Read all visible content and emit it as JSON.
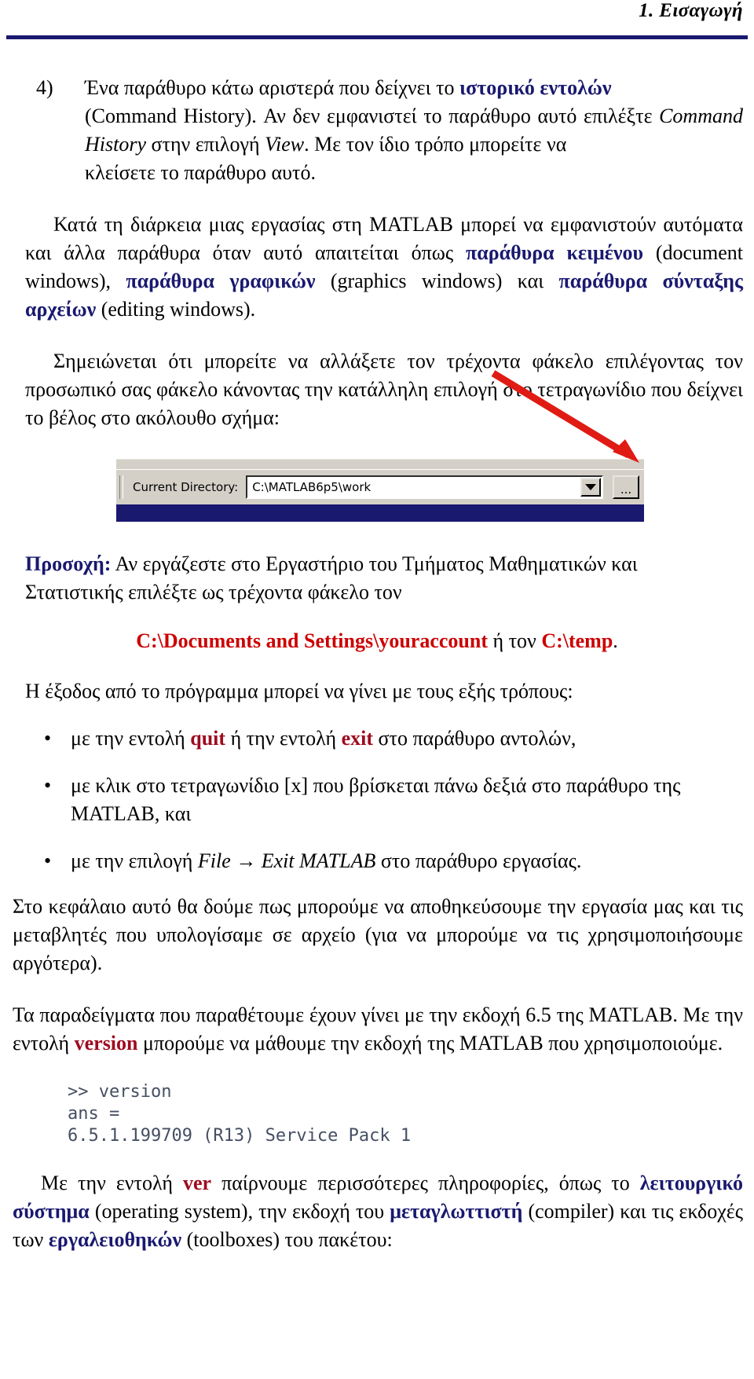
{
  "header": {
    "title": "1. Εισαγωγή",
    "rule_color": "#191970"
  },
  "colors": {
    "navy": "#191970",
    "red": "#cc0000",
    "dark_red": "#9e0b1f",
    "arrow_red": "#e01b14",
    "code_text": "#454f63",
    "toolbar_face": "#d4d0c8"
  },
  "item4": {
    "marker": "4)",
    "line1_pre": "Ένα παράθυρο κάτω αριστερά που δείχνει το ",
    "line1_em": "ιστορικό εντολών",
    "line2_pre": "(Command History). Αν δεν εμφανιστεί το παράθυρο αυτό επιλέξτε ",
    "line2_it1": "Command History",
    "line2_mid": " στην επιλογή ",
    "line2_it2": "View",
    "line2_post": ". Με τον ίδιο τρόπο μπορείτε να",
    "line3": "κλείσετε το παράθυρο αυτό."
  },
  "para_windows": {
    "t1": "Κατά τη διάρκεια μιας εργασίας στη MATLAB μπορεί να εμφανιστούν αυτόματα και άλλα παράθυρα όταν αυτό απαιτείται όπως ",
    "em1": "παράθυρα κειμένου",
    "t2": " (document windows), ",
    "em2": "παράθυρα γραφικών",
    "t3": " (graphics windows) και ",
    "em3": "παράθυρα σύνταξης αρχείων",
    "t4": " (editing windows)."
  },
  "para_folder": {
    "text": "Σημειώνεται ότι μπορείτε να αλλάξετε τον τρέχοντα φάκελο επιλέγοντας τον προσωπικό σας φάκελο κάνοντας την κατάλληλη επιλογή στο τετραγωνίδιο που δείχνει το βέλος στο ακόλουθο σχήμα:"
  },
  "screenshot": {
    "label": "Current Directory:",
    "path_value": "C:\\MATLAB6p5\\work",
    "dropdown_icon": "chevron-down-icon",
    "browse_label": "...",
    "arrow_icon": "red-arrow-annotation"
  },
  "para_attention": {
    "bold": "Προσοχή:",
    "t1": " Αν εργάζεστε στο Εργαστήριο του Τμήματος Μαθηματικών και ",
    "t2": "Στατιστικής επιλέξτε ως τρέχοντα φάκελο τον"
  },
  "path_line": {
    "path1": "C:\\Documents and Settings\\youraccount",
    "middle": " ή τον ",
    "path2": "C:\\temp",
    "end": "."
  },
  "para_exit": {
    "text": "Η έξοδος από το πρόγραμμα μπορεί να γίνει με τους εξής τρόπους:"
  },
  "bullets": {
    "dot": "•",
    "items": [
      {
        "t1": "με την εντολή ",
        "cmd1": "quit",
        "t2": " ή την εντολή ",
        "cmd2": "exit",
        "t3": " στο παράθυρο αντολών,"
      },
      {
        "line1": "με κλικ στο τετραγωνίδιο [x] που βρίσκεται πάνω δεξιά στο παράθυρο της",
        "line2": "MATLAB, και"
      },
      {
        "t1": "με την επιλογή ",
        "menu": "File → Exit MATLAB",
        "t2": " στο παράθυρο εργασίας."
      }
    ]
  },
  "para_chapter": {
    "text": "Στο κεφάλαιο αυτό θα δούμε πως μπορούμε να αποθηκεύσουμε την εργασία μας και τις μεταβλητές που υπολογίσαμε σε αρχείο (για να μπορούμε να τις χρησιμοποιήσουμε αργότερα)."
  },
  "para_version": {
    "t1": "Τα παραδείγματα που παραθέτουμε έχουν γίνει με την εκδοχή 6.5 της MATLAB. Με την εντολή ",
    "cmd": "version",
    "t2": " μπορούμε να μάθουμε την εκδοχή της MATLAB που χρησιμοποιούμε."
  },
  "code_block": {
    "lines": ">> version\nans =\n6.5.1.199709 (R13) Service Pack 1"
  },
  "para_ver": {
    "t1": "Με την εντολή ",
    "cmd": "ver",
    "t2": " παίρνουμε περισσότερες πληροφορίες, όπως το ",
    "em1": "λειτουργικό σύστημα",
    "t3": " (operating system), την εκδοχή του ",
    "em2": "μεταγλωττιστή",
    "t4": " (compiler) και τις εκδοχές των ",
    "em3": "εργαλειοθηκών",
    "t5": " (toolboxes) του πακέτου:"
  }
}
